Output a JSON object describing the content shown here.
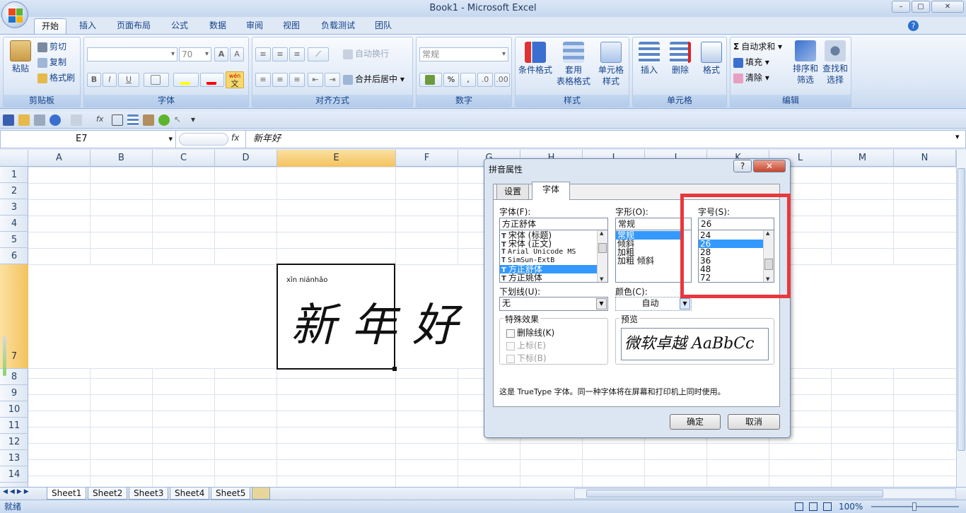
{
  "window": {
    "title": "Book1 - Microsoft Excel",
    "min": "–",
    "max": "▢",
    "close": "✕"
  },
  "ribbon_tabs": [
    "开始",
    "插入",
    "页面布局",
    "公式",
    "数据",
    "审阅",
    "视图",
    "负载测试",
    "团队"
  ],
  "clipboard": {
    "paste": "粘贴",
    "cut": "剪切",
    "copy": "复制",
    "format_painter": "格式刷",
    "label": "剪贴板"
  },
  "font_group": {
    "size": "70",
    "grow": "A",
    "shrink": "A",
    "bold": "B",
    "italic": "I",
    "underline": "U",
    "wen": "wén",
    "zi": "文",
    "label": "字体"
  },
  "align_group": {
    "wrap": "自动换行",
    "merge": "合并后居中",
    "label": "对齐方式"
  },
  "number_group": {
    "format": "常规",
    "percent": "%",
    "comma": ",",
    "label": "数字"
  },
  "styles_group": {
    "cond": "条件格式",
    "table1": "套用",
    "table2": "表格格式",
    "cell1": "单元格",
    "cell2": "样式",
    "label": "样式"
  },
  "cells_group": {
    "insert": "插入",
    "delete": "删除",
    "format": "格式",
    "label": "单元格"
  },
  "edit_group": {
    "autosum": "自动求和",
    "fill": "填充",
    "clear": "清除",
    "sort1": "排序和",
    "sort2": "筛选",
    "find1": "查找和",
    "find2": "选择",
    "label": "编辑"
  },
  "formula_bar": {
    "name_box": "E7",
    "fx": "fx",
    "content": "新年好"
  },
  "columns": [
    "A",
    "B",
    "C",
    "D",
    "E",
    "F",
    "G",
    "H",
    "I",
    "J",
    "K",
    "L",
    "M",
    "N"
  ],
  "rows": [
    "1",
    "2",
    "3",
    "4",
    "5",
    "6",
    "7",
    "8",
    "9",
    "10",
    "11",
    "12",
    "13",
    "14"
  ],
  "cell": {
    "pinyin": "xīn niánhǎo",
    "text": "新年好"
  },
  "sheets": [
    "Sheet1",
    "Sheet2",
    "Sheet3",
    "Sheet4",
    "Sheet5"
  ],
  "status": {
    "ready": "就绪",
    "zoom": "100%"
  },
  "dialog": {
    "title": "拼音属性",
    "tabs": [
      "设置",
      "字体"
    ],
    "font_label": "字体(F):",
    "font_value": "方正舒体",
    "fonts": [
      "宋体 (标题)",
      "宋体 (正文)",
      "Arial Unicode MS",
      "SimSun-ExtB",
      "方正舒体",
      "方正姚体"
    ],
    "style_label": "字形(O):",
    "style_value": "常规",
    "styles": [
      "常规",
      "倾斜",
      "加粗",
      "加粗 倾斜"
    ],
    "size_label": "字号(S):",
    "size_value": "26",
    "sizes": [
      "24",
      "26",
      "28",
      "36",
      "48",
      "72"
    ],
    "underline_label": "下划线(U):",
    "underline_value": "无",
    "color_label": "颜色(C):",
    "color_value": "自动",
    "effects_label": "特殊效果",
    "strike": "删除线(K)",
    "sup": "上标(E)",
    "sub": "下标(B)",
    "preview_label": "预览",
    "preview_text": "微软卓越  AaBbCc",
    "info": "这是 TrueType 字体。同一种字体将在屏幕和打印机上同时使用。",
    "ok": "确定",
    "cancel": "取消",
    "help": "?",
    "close": "✕"
  },
  "colors": {
    "highlight": "#e8383d",
    "selection": "#3399ff"
  }
}
